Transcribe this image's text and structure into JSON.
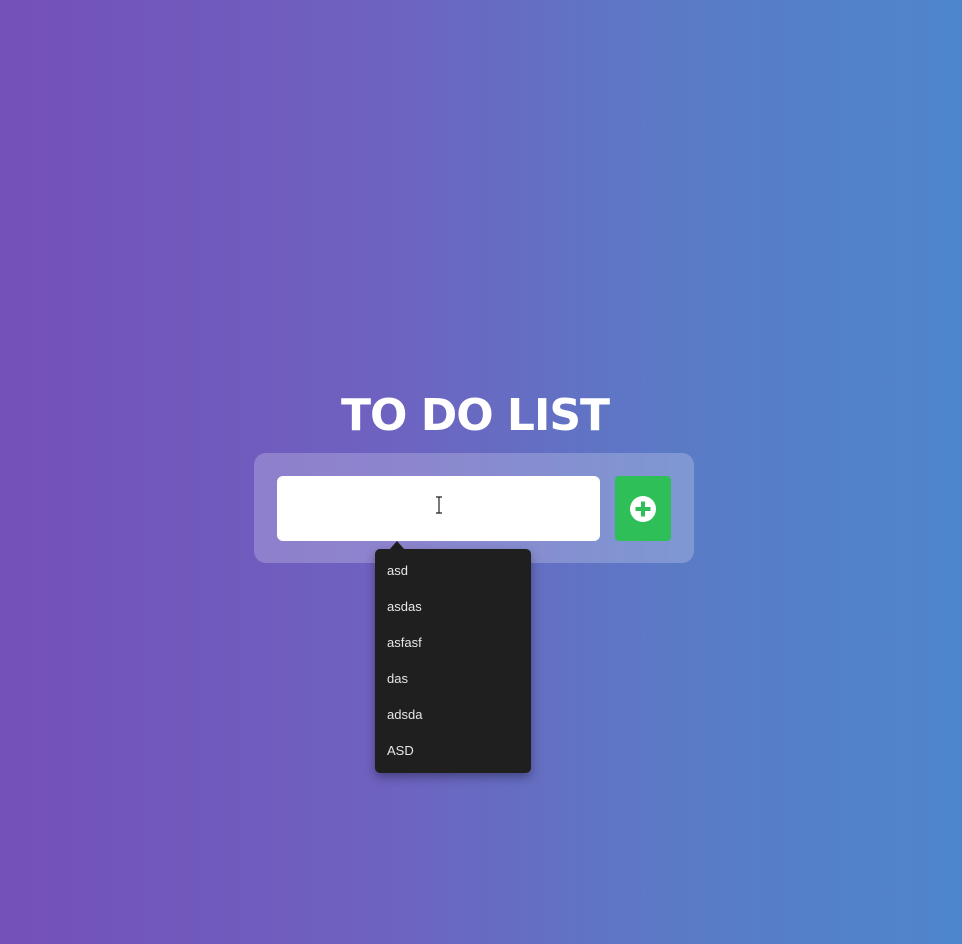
{
  "header": {
    "title": "TO DO LIST"
  },
  "form": {
    "input_value": "",
    "input_placeholder": "",
    "add_button_icon": "plus-circle-icon"
  },
  "autocomplete": {
    "items": [
      {
        "label": "asd"
      },
      {
        "label": "asdas"
      },
      {
        "label": "asfasf"
      },
      {
        "label": "das"
      },
      {
        "label": "adsda"
      },
      {
        "label": "ASD"
      }
    ]
  },
  "colors": {
    "background_start": "#7450b9",
    "background_end": "#4d86cc",
    "add_button": "#2ebf58",
    "dropdown_bg": "#1f1f1f"
  }
}
